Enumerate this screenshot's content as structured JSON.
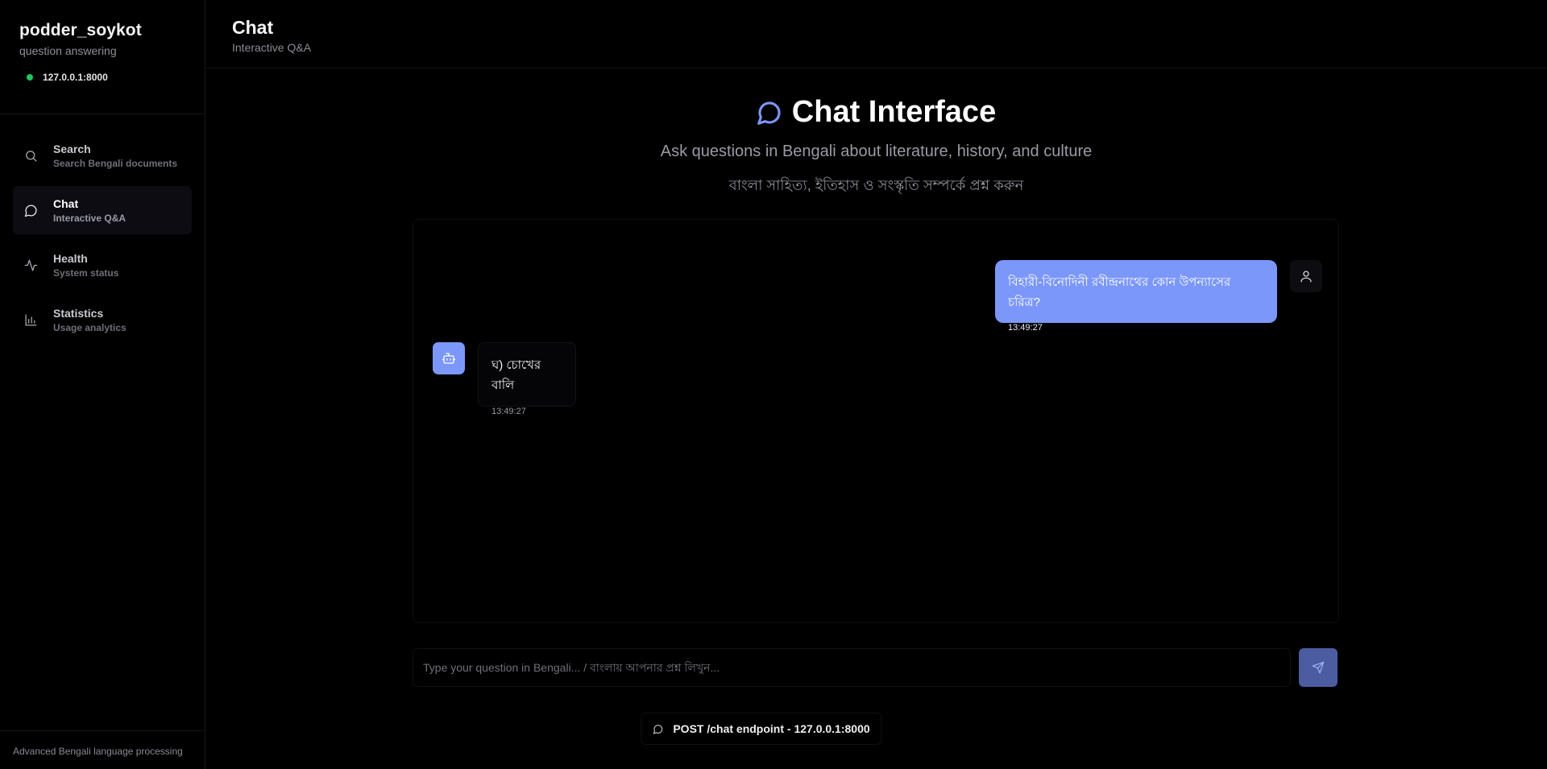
{
  "sidebar": {
    "brand_title": "podder_soykot",
    "brand_subtitle": "question answering",
    "server_status_color": "#22c55e",
    "server_address": "127.0.0.1:8000",
    "items": [
      {
        "label": "Search",
        "sublabel": "Search Bengali documents",
        "icon": "search-icon",
        "active": false
      },
      {
        "label": "Chat",
        "sublabel": "Interactive Q&A",
        "icon": "chat-bubble-icon",
        "active": true
      },
      {
        "label": "Health",
        "sublabel": "System status",
        "icon": "activity-icon",
        "active": false
      },
      {
        "label": "Statistics",
        "sublabel": "Usage analytics",
        "icon": "bar-chart-icon",
        "active": false
      }
    ],
    "footer": "Advanced Bengali language processing"
  },
  "header": {
    "title": "Chat",
    "subtitle": "Interactive Q&A"
  },
  "hero": {
    "icon": "chat-bubble-icon",
    "title": "Chat Interface",
    "subtitle_en": "Ask questions in Bengali about literature, history, and culture",
    "subtitle_bn": "বাংলা সাহিত্য, ইতিহাস ও সংস্কৃতি সম্পর্কে প্রশ্ন করুন"
  },
  "messages": [
    {
      "role": "user",
      "text": "বিহারী-বিনোদিনী রবীন্দ্রনাথের কোন উপন্যাসের চরিত্র?",
      "time": "13:49:27",
      "avatar_icon": "user-icon"
    },
    {
      "role": "bot",
      "text": "ঘ) চোখের বালি",
      "time": "13:49:27",
      "avatar_icon": "bot-icon"
    }
  ],
  "composer": {
    "placeholder": "Type your question in Bengali... / বাংলায় আপনার প্রশ্ন লিখুন...",
    "value": "",
    "send_icon": "send-icon"
  },
  "endpoint_label": "POST /chat endpoint - 127.0.0.1:8000",
  "colors": {
    "accent": "#7b97fa",
    "send_button": "#4b5da0",
    "background": "#000000"
  }
}
